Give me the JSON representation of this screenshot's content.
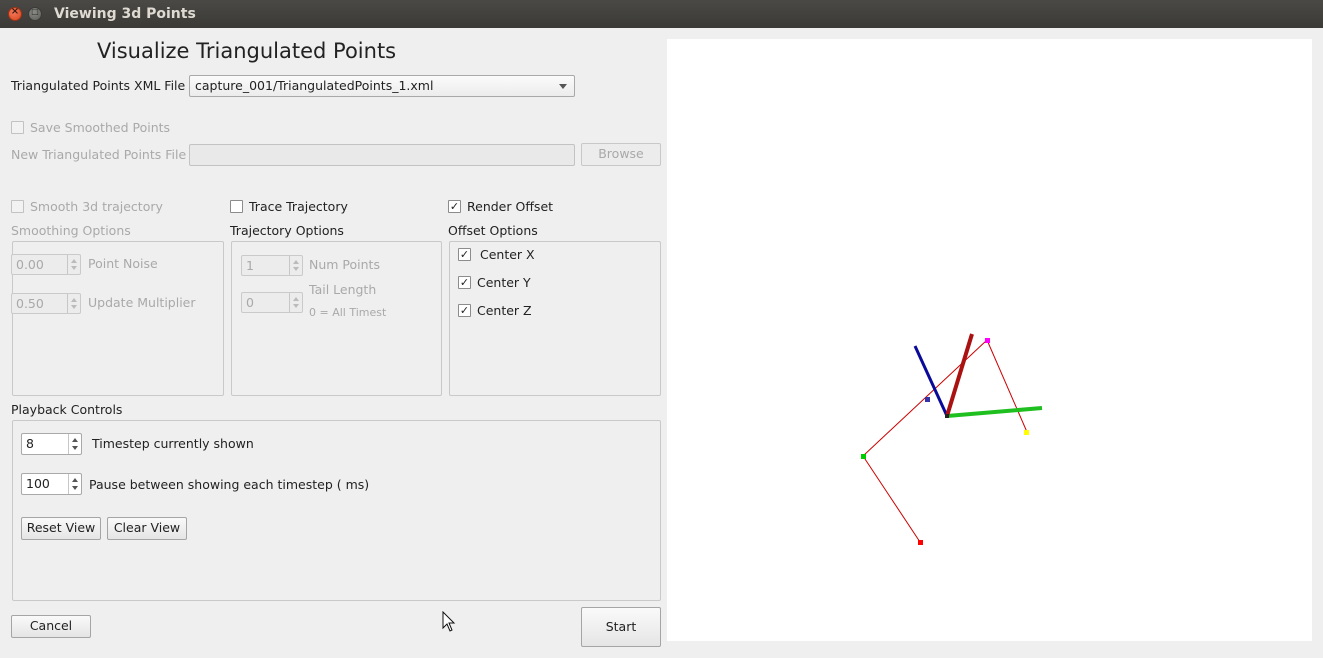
{
  "window": {
    "title": "Viewing 3d Points"
  },
  "heading": "Visualize Triangulated Points",
  "xml_file": {
    "label": "Triangulated Points XML File",
    "value": "capture_001/TriangulatedPoints_1.xml"
  },
  "save_smoothed": {
    "label": "Save Smoothed Points",
    "checked": false
  },
  "new_file": {
    "label": "New Triangulated Points File",
    "value": "",
    "browse_label": "Browse"
  },
  "smoothing": {
    "checkbox_label": "Smooth 3d trajectory",
    "group_label": "Smoothing Options",
    "point_noise": {
      "value": "0.00",
      "label": "Point Noise"
    },
    "update_multiplier": {
      "value": "0.50",
      "label": "Update Multiplier"
    }
  },
  "trajectory": {
    "checkbox_label": "Trace Trajectory",
    "group_label": "Trajectory Options",
    "num_points": {
      "value": "1",
      "label": "Num Points"
    },
    "tail_length": {
      "value": "0",
      "label": "Tail Length",
      "hint": "0 = All Timest"
    }
  },
  "offset": {
    "checkbox_label": "Render Offset",
    "checked": true,
    "group_label": "Offset Options",
    "center_x": "Center X",
    "center_y": "Center Y",
    "center_z": "Center Z"
  },
  "playback": {
    "group_label": "Playback Controls",
    "timestep": {
      "value": "8",
      "label": "Timestep currently shown"
    },
    "pause": {
      "value": "100",
      "label": "Pause between showing each timestep ( ms)"
    },
    "reset_label": "Reset View",
    "clear_label": "Clear View"
  },
  "footer": {
    "cancel_label": "Cancel",
    "start_label": "Start"
  },
  "colors": {
    "x_axis": "#1fbf1f",
    "y_axis": "#0a0a9a",
    "z_axis": "#aa1111",
    "skeleton_line": "#cc0000",
    "point_colors": [
      "#ff00ff",
      "#ffff00",
      "#00cc00",
      "#ff0000",
      "#3333aa"
    ]
  }
}
